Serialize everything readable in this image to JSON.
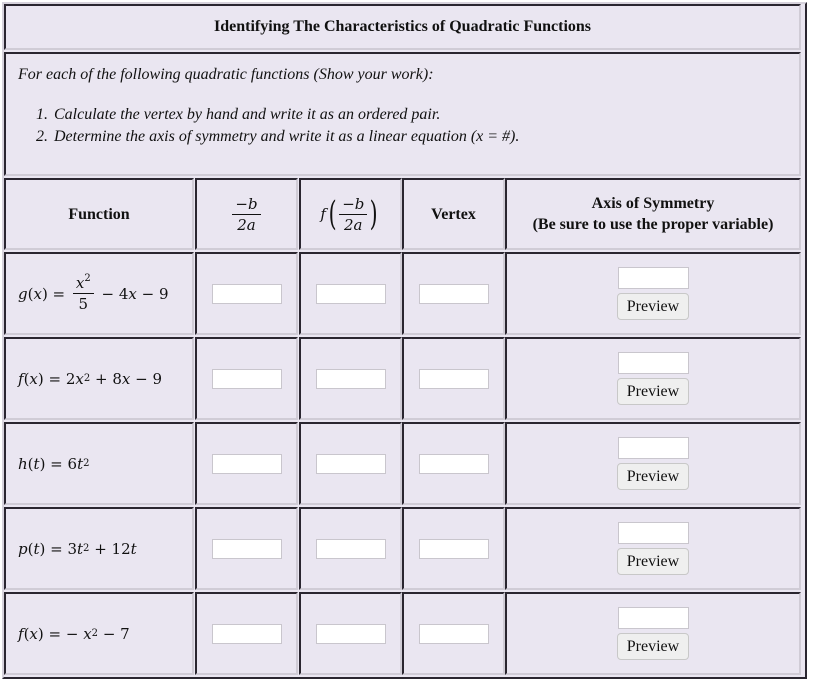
{
  "title": "Identifying The Characteristics of Quadratic Functions",
  "instructions": {
    "lead": "For each of the following quadratic functions (Show your work):",
    "steps": [
      "Calculate the vertex by hand and write it as an ordered pair.",
      "Determine the axis of symmetry and write it as a linear equation (x = #)."
    ]
  },
  "table": {
    "headers": {
      "function": "Function",
      "neg_b_over_2a": {
        "num": "−b",
        "den": "2a"
      },
      "f_of": {
        "fn": "f",
        "num": "−b",
        "den": "2a"
      },
      "vertex": "Vertex",
      "axis_line1": "Axis of Symmetry",
      "axis_line2": "(Be sure to use the proper variable)"
    },
    "preview_label": "Preview",
    "rows": [
      {
        "name": "g",
        "var": "x",
        "expr": "g(x) = x²/5 − 4x − 9",
        "parts": {
          "lhs": "g",
          "arg": "x",
          "frac_num": "x",
          "frac_den": "5",
          "rest": "− 4x − 9"
        },
        "neg_b_over_2a": "",
        "f_value": "",
        "vertex": "",
        "axis": ""
      },
      {
        "name": "f",
        "var": "x",
        "expr": "f(x) = 2x² + 8x − 9",
        "parts": {
          "lhs": "f",
          "arg": "x",
          "coef": "2",
          "rest": "+ 8x − 9"
        },
        "neg_b_over_2a": "",
        "f_value": "",
        "vertex": "",
        "axis": ""
      },
      {
        "name": "h",
        "var": "t",
        "expr": "h(t) = 6t²",
        "parts": {
          "lhs": "h",
          "arg": "t",
          "coef": "6",
          "rest": ""
        },
        "neg_b_over_2a": "",
        "f_value": "",
        "vertex": "",
        "axis": ""
      },
      {
        "name": "p",
        "var": "t",
        "expr": "p(t) = 3t² + 12t",
        "parts": {
          "lhs": "p",
          "arg": "t",
          "coef": "3",
          "rest": "+ 12t"
        },
        "neg_b_over_2a": "",
        "f_value": "",
        "vertex": "",
        "axis": ""
      },
      {
        "name": "f",
        "var": "x",
        "expr": "f(x) = −x² − 7",
        "parts": {
          "lhs": "f",
          "arg": "x",
          "coef": "− ",
          "rest": "− 7"
        },
        "neg_b_over_2a": "",
        "f_value": "",
        "vertex": "",
        "axis": ""
      }
    ]
  }
}
